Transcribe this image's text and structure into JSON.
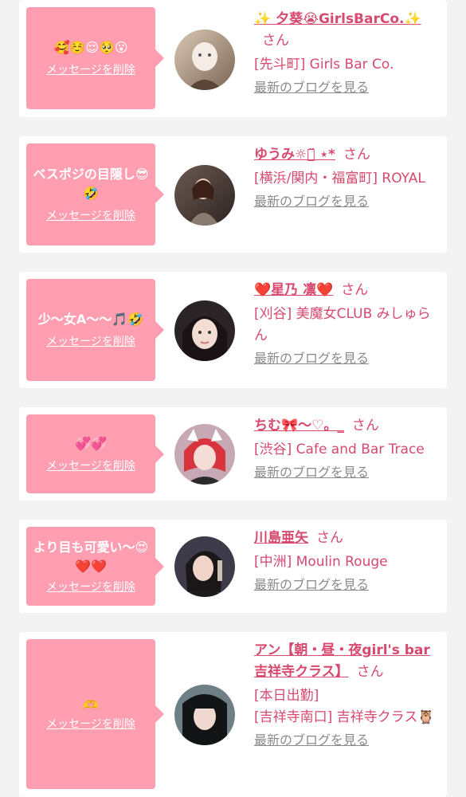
{
  "common": {
    "delete_label": "メッセージを削除",
    "blog_label": "最新のブログを見る",
    "honorific": "さん"
  },
  "entries": [
    {
      "bubble_text": "🥰☺️😌🥺😮",
      "name": "✨ 夕葵😭GirlsBarCo.✨",
      "shop": "[先斗町] Girls Bar Co.",
      "shop2": ""
    },
    {
      "bubble_text": "ベスポジの目隠し😎🤣",
      "name": "ゆうみ☼︎⌒̈ ⋆*",
      "shop": "[横浜/関内・福富町] ROYAL",
      "shop2": ""
    },
    {
      "bubble_text": "少〜女A〜〜🎵🤣",
      "name": "❤️星乃 凛❤️",
      "shop": "[刈谷] 美魔女CLUB みしゅらん",
      "shop2": ""
    },
    {
      "bubble_text": "💞💞",
      "name": "ちむ🎀〜♡。_",
      "shop": "[渋谷] Cafe and Bar Trace",
      "shop2": ""
    },
    {
      "bubble_text": "より目も可愛い〜😍❤️❤️",
      "name": "川島亜矢",
      "shop": "[中洲] Moulin Rouge",
      "shop2": ""
    },
    {
      "bubble_text": "🫶",
      "name": "アン【朝・昼・夜girl's bar吉祥寺クラス】",
      "shop": "[本日出勤]",
      "shop2": "[吉祥寺南口] 吉祥寺クラス🦉"
    }
  ]
}
